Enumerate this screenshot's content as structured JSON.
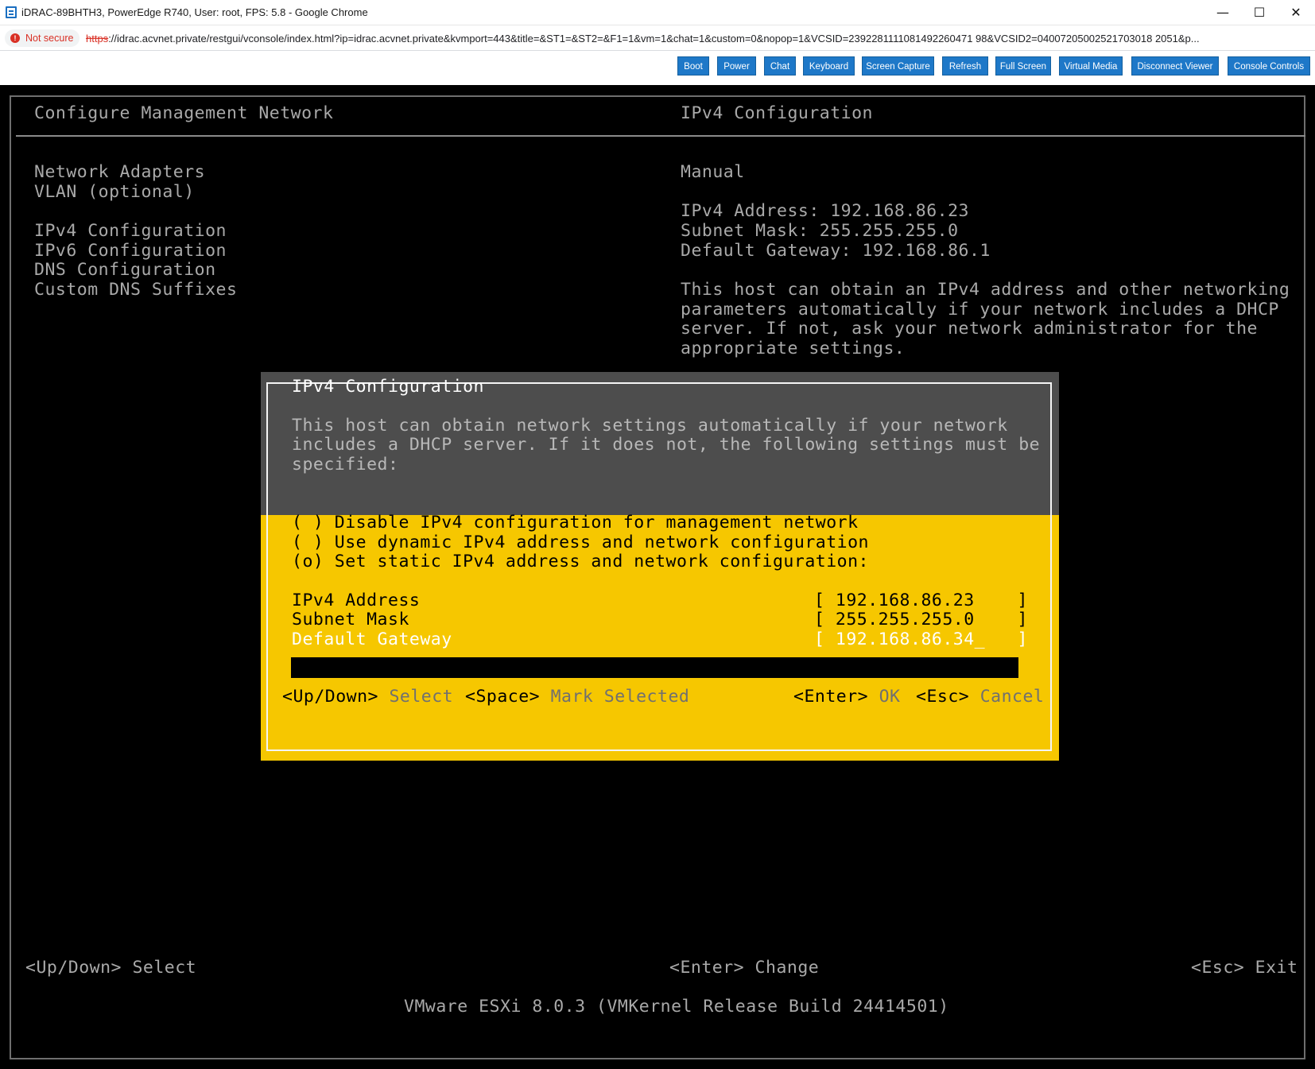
{
  "window": {
    "title": "iDRAC-89BHTH3, PowerEdge R740, User: root, FPS: 5.8 - Google Chrome",
    "minimize": "—",
    "maximize": "☐",
    "close": "✕"
  },
  "address": {
    "security_label": "Not secure",
    "url_scheme": "https",
    "url_rest": "://idrac.acvnet.private/restgui/vconsole/index.html?ip=idrac.acvnet.private&kvmport=443&title=&ST1=&ST2=&F1=1&vm=1&chat=1&custom=0&nopop=1&VCSID=2392281111081492260471 98&VCSID2=04007205002521703018 2051&p..."
  },
  "toolbar": {
    "buttons": [
      "Boot",
      "Power",
      "Chat",
      "Keyboard",
      "Screen Capture",
      "Refresh",
      "Full Screen",
      "Virtual Media",
      "Disconnect Viewer",
      "Console Controls"
    ]
  },
  "console": {
    "left_title": "Configure Management Network",
    "right_title": "IPv4 Configuration",
    "menu": [
      "Network Adapters",
      "VLAN (optional)",
      "IPv4 Configuration",
      "IPv6 Configuration",
      "DNS Configuration",
      "Custom DNS Suffixes"
    ],
    "mode": "Manual",
    "ipv4_line": "IPv4 Address: 192.168.86.23",
    "subnet_line": "Subnet Mask: 255.255.255.0",
    "gateway_line": "Default Gateway: 192.168.86.1",
    "description": [
      "This host can obtain an IPv4 address and other networking",
      "parameters automatically if your network includes a DHCP",
      "server. If not, ask your network administrator for the",
      "appropriate settings."
    ],
    "footer_left": "<Up/Down> Select",
    "footer_mid": "<Enter> Change",
    "footer_right": "<Esc> Exit",
    "build": "VMware ESXi 8.0.3 (VMKernel Release Build 24414501)"
  },
  "dialog": {
    "title": "IPv4 Configuration",
    "description": [
      "This host can obtain network settings automatically if your network",
      "includes a DHCP server. If it does not, the following settings must be",
      "specified:"
    ],
    "options": [
      "( ) Disable IPv4 configuration for management network",
      "( ) Use dynamic IPv4 address and network configuration",
      "(o) Set static IPv4 address and network configuration:"
    ],
    "fields": [
      {
        "label": "IPv4 Address",
        "value": "[ 192.168.86.23    ]"
      },
      {
        "label": "Subnet Mask",
        "value": "[ 255.255.255.0    ]"
      },
      {
        "label": "Default Gateway",
        "value": "[ 192.168.86.34_   ]"
      }
    ],
    "hints": {
      "updown_key": "<Up/Down>",
      "updown_text": "Select",
      "space_key": "<Space>",
      "space_text": "Mark Selected",
      "enter_key": "<Enter>",
      "enter_text": "OK",
      "esc_key": "<Esc>",
      "esc_text": "Cancel"
    }
  },
  "colors": {
    "dialog_yellow": "#f6c700",
    "dialog_gray": "#4d4d4d",
    "toolbar_button": "#1e78c8",
    "not_secure_red": "#d93025"
  }
}
